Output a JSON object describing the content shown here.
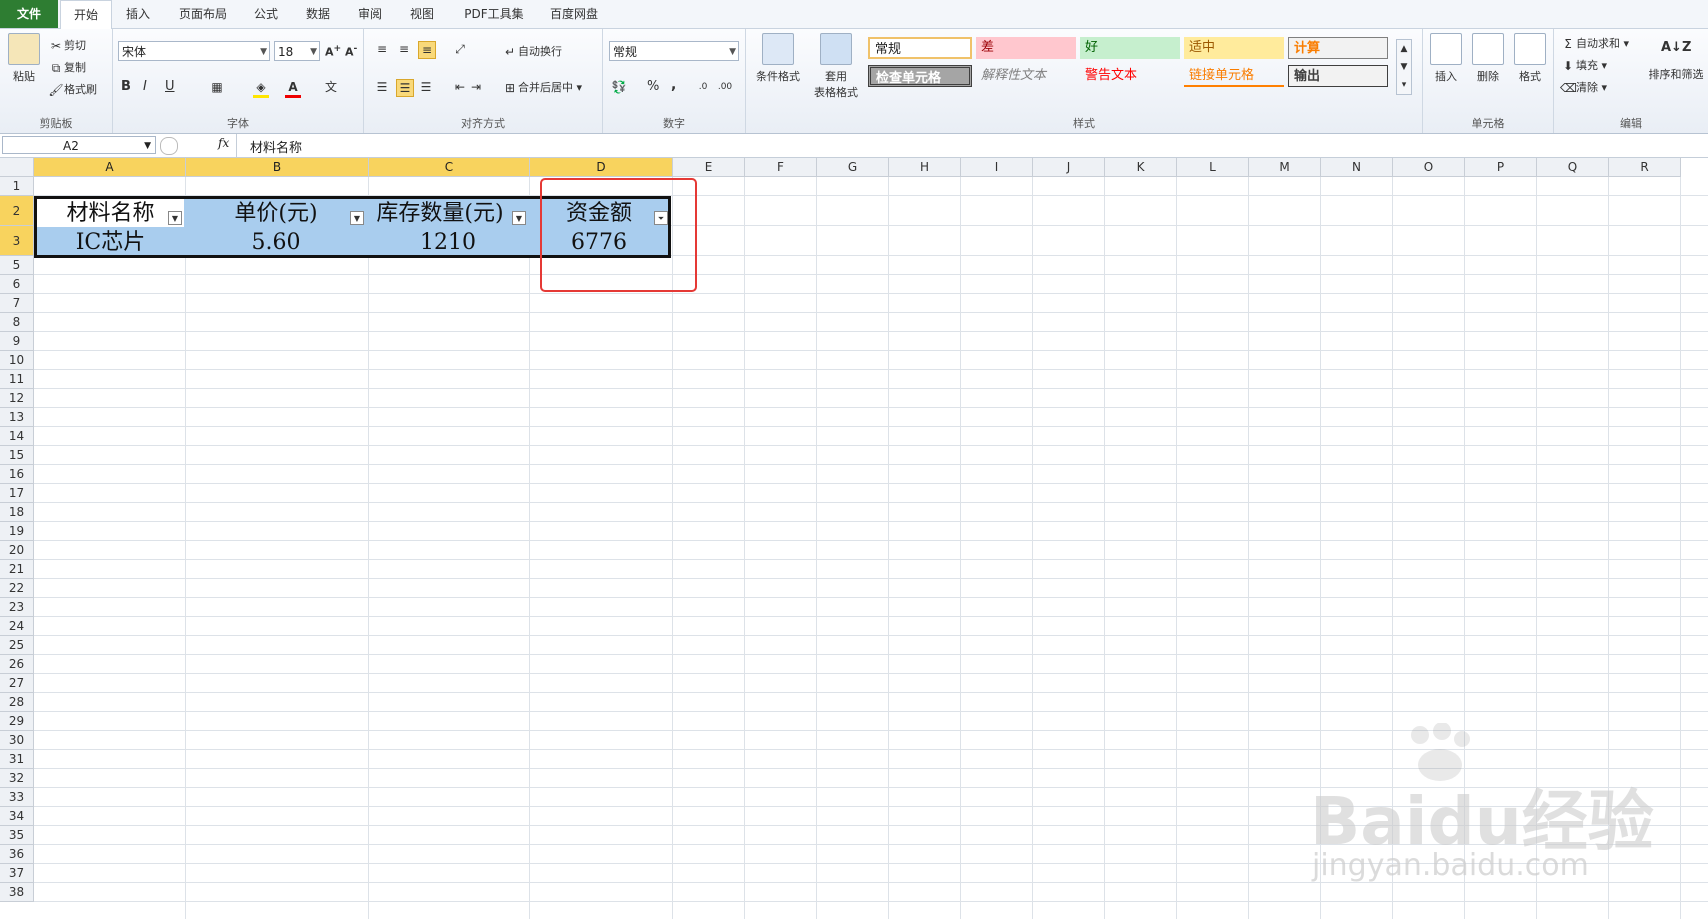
{
  "tabs": [
    "文件",
    "开始",
    "插入",
    "页面布局",
    "公式",
    "数据",
    "审阅",
    "视图",
    "PDF工具集",
    "百度网盘"
  ],
  "clipboard": {
    "paste": "粘贴",
    "cut": "剪切",
    "copy": "复制",
    "format_painter": "格式刷",
    "title": "剪贴板"
  },
  "font": {
    "name": "宋体",
    "size": "18",
    "bold": "B",
    "italic": "I",
    "underline": "U",
    "title": "字体"
  },
  "alignment": {
    "wrap": "自动换行",
    "merge": "合并后居中",
    "title": "对齐方式"
  },
  "number": {
    "format": "常规",
    "percent": "%",
    "comma": ",",
    "title": "数字"
  },
  "styles": {
    "conditional": "条件格式",
    "table_format_1": "套用",
    "table_format_2": "表格格式",
    "normal": "常规",
    "bad": "差",
    "good": "好",
    "neutral": "适中",
    "calculation": "计算",
    "check_cell": "检查单元格",
    "explanatory": "解释性文本",
    "warning": "警告文本",
    "linked": "链接单元格",
    "output": "输出",
    "title": "样式"
  },
  "cells_group": {
    "insert": "插入",
    "delete": "删除",
    "format": "格式",
    "title": "单元格"
  },
  "editing": {
    "autosum": "自动求和",
    "fill": "填充",
    "clear": "清除",
    "sort": "排序和筛选",
    "title": "编辑"
  },
  "formula_bar": {
    "name_box": "A2",
    "fx": "fx",
    "content": "材料名称"
  },
  "columns": [
    "A",
    "B",
    "C",
    "D",
    "E",
    "F",
    "G",
    "H",
    "I",
    "J",
    "K",
    "L",
    "M",
    "N",
    "O",
    "P",
    "Q",
    "R"
  ],
  "rows": [
    "1",
    "2",
    "3",
    "5",
    "6",
    "7",
    "8",
    "9",
    "10",
    "11",
    "12",
    "13",
    "14",
    "15",
    "16",
    "17",
    "18",
    "19",
    "20",
    "21",
    "22",
    "23",
    "24",
    "25",
    "26",
    "27",
    "28",
    "29",
    "30",
    "31",
    "32",
    "33",
    "34",
    "35",
    "36",
    "37",
    "38"
  ],
  "table": {
    "headers": [
      "材料名称",
      "单价(元)",
      "库存数量(元)",
      "资金额"
    ],
    "row": [
      "IC芯片",
      "5.60",
      "1210",
      "6776"
    ]
  },
  "watermark": {
    "brand": "Baidu经验",
    "url": "jingyan.baidu.com"
  },
  "colors": {
    "file_tab": "#2e7d32",
    "header_fill": "#a9cdee",
    "selected_header": "#f8d35e",
    "highlight_box": "#e53935"
  }
}
